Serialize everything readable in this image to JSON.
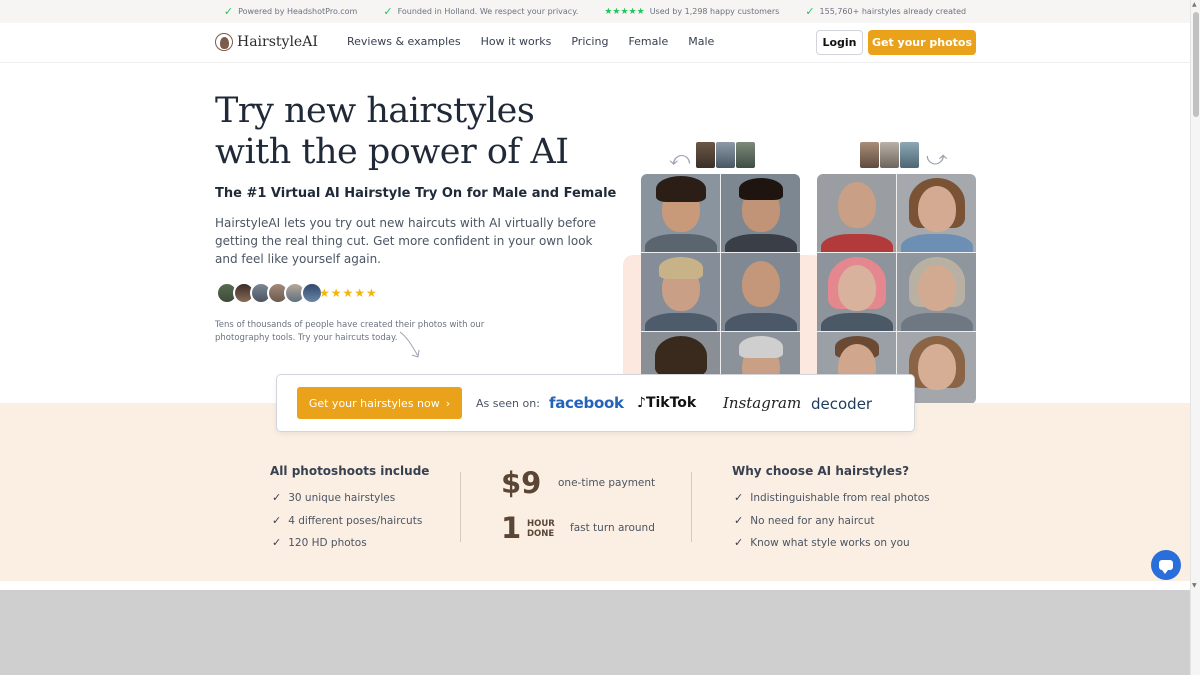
{
  "topbar": [
    {
      "icon": "check-icon",
      "text": "Powered by HeadshotPro.com"
    },
    {
      "icon": "check-icon",
      "text": "Founded in Holland. We respect your privacy."
    },
    {
      "icon": "stars-icon",
      "stars": "★★★★★",
      "text": "Used by 1,298 happy customers"
    },
    {
      "icon": "check-icon",
      "text": "155,760+ hairstyles already created"
    }
  ],
  "nav": {
    "logo": "HairstyleAI",
    "links": [
      "Reviews & examples",
      "How it works",
      "Pricing",
      "Female",
      "Male"
    ],
    "login": "Login",
    "cta": "Get your photos"
  },
  "hero": {
    "title_line1": "Try new hairstyles",
    "title_line2": "with the power of AI",
    "subtitle": "The #1 Virtual AI Hairstyle Try On for Male and Female",
    "description": "HairstyleAI lets you try out new haircuts with AI virtually before getting the real thing cut. Get more confident in your own look and feel like yourself again.",
    "rating": "★★★★★",
    "trust": "Tens of thousands of people have created their photos with our photography tools. Try your haircuts today."
  },
  "cta_card": {
    "button": "Get your hairstyles now",
    "seen_on": "As seen on:",
    "brands": [
      "facebook",
      "TikTok",
      "Instagram",
      "decoder"
    ]
  },
  "features": {
    "left_title": "All photoshoots include",
    "left_items": [
      "30 unique hairstyles",
      "4 different poses/haircuts",
      "120 HD photos"
    ],
    "price": "$9",
    "price_label": "one-time payment",
    "turnaround_number": "1",
    "turnaround_unit_1": "HOUR",
    "turnaround_unit_2": "DONE",
    "turnaround_label": "fast turn around",
    "right_title": "Why choose AI hairstyles?",
    "right_items": [
      "Indistinguishable from real photos",
      "No need for any haircut",
      "Know what style works on you"
    ]
  },
  "colors": {
    "accent": "#eba21b",
    "peach": "#fbeee3",
    "chat": "#2a6edb"
  }
}
